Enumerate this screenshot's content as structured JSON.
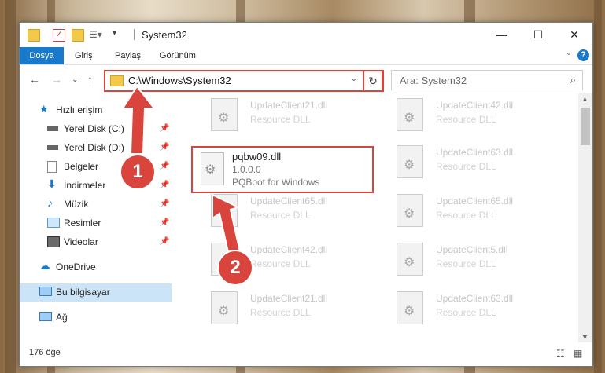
{
  "window": {
    "title": "System32"
  },
  "menu": {
    "tabs": [
      "Dosya",
      "Giriş",
      "Paylaş",
      "Görünüm"
    ],
    "help": "?"
  },
  "address": {
    "path": "C:\\Windows\\System32"
  },
  "search": {
    "placeholder": "Ara: System32"
  },
  "sidebar": {
    "items": [
      {
        "label": "Hızlı erişim",
        "icon": "star-icon"
      },
      {
        "label": "Yerel Disk (C:)",
        "icon": "drive-icon",
        "pinned": true
      },
      {
        "label": "Yerel Disk (D:)",
        "icon": "drive-icon",
        "pinned": true
      },
      {
        "label": "Belgeler",
        "icon": "documents-icon",
        "pinned": true
      },
      {
        "label": "İndirmeler",
        "icon": "download-icon",
        "pinned": true
      },
      {
        "label": "Müzik",
        "icon": "music-icon",
        "pinned": true
      },
      {
        "label": "Resimler",
        "icon": "pictures-icon",
        "pinned": true
      },
      {
        "label": "Videolar",
        "icon": "videos-icon",
        "pinned": true
      },
      {
        "label": "OneDrive",
        "icon": "cloud-icon"
      },
      {
        "label": "Bu bilgisayar",
        "icon": "computer-icon",
        "selected": true
      },
      {
        "label": "Ağ",
        "icon": "network-icon"
      }
    ]
  },
  "files": {
    "left": [
      {
        "name": "UpdateClient21.dll",
        "desc": "Resource DLL"
      },
      {
        "name": "UpdateClient65.dll",
        "desc": "Resource DLL"
      },
      {
        "name": "UpdateClient42.dll",
        "desc": "Resource DLL"
      },
      {
        "name": "UpdateClient21.dll",
        "desc": "Resource DLL"
      }
    ],
    "right": [
      {
        "name": "UpdateClient42.dll",
        "desc": "Resource DLL"
      },
      {
        "name": "UpdateClient63.dll",
        "desc": "Resource DLL"
      },
      {
        "name": "UpdateClient65.dll",
        "desc": "Resource DLL"
      },
      {
        "name": "UpdateClient5.dll",
        "desc": "Resource DLL"
      },
      {
        "name": "UpdateClient63.dll",
        "desc": "Resource DLL"
      }
    ],
    "highlighted": {
      "name": "pqbw09.dll",
      "version": "1.0.0.0",
      "desc": "PQBoot for Windows"
    }
  },
  "status": {
    "count": "176 öğe"
  },
  "annotations": {
    "step1": "1",
    "step2": "2"
  },
  "colors": {
    "accent": "#1979ca",
    "highlight": "#d9443d"
  }
}
